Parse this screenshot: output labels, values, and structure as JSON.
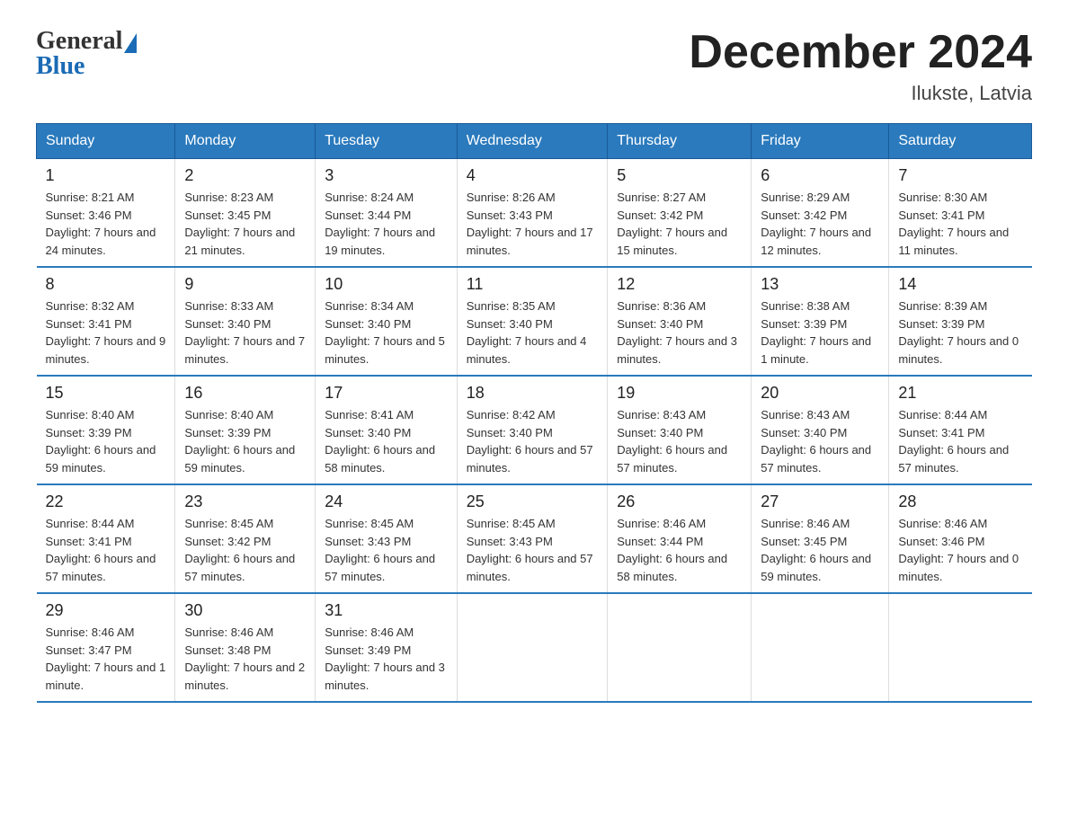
{
  "logo": {
    "general": "General",
    "blue": "Blue"
  },
  "title": "December 2024",
  "location": "Ilukste, Latvia",
  "days_of_week": [
    "Sunday",
    "Monday",
    "Tuesday",
    "Wednesday",
    "Thursday",
    "Friday",
    "Saturday"
  ],
  "weeks": [
    [
      {
        "day": "1",
        "sunrise": "8:21 AM",
        "sunset": "3:46 PM",
        "daylight": "7 hours and 24 minutes."
      },
      {
        "day": "2",
        "sunrise": "8:23 AM",
        "sunset": "3:45 PM",
        "daylight": "7 hours and 21 minutes."
      },
      {
        "day": "3",
        "sunrise": "8:24 AM",
        "sunset": "3:44 PM",
        "daylight": "7 hours and 19 minutes."
      },
      {
        "day": "4",
        "sunrise": "8:26 AM",
        "sunset": "3:43 PM",
        "daylight": "7 hours and 17 minutes."
      },
      {
        "day": "5",
        "sunrise": "8:27 AM",
        "sunset": "3:42 PM",
        "daylight": "7 hours and 15 minutes."
      },
      {
        "day": "6",
        "sunrise": "8:29 AM",
        "sunset": "3:42 PM",
        "daylight": "7 hours and 12 minutes."
      },
      {
        "day": "7",
        "sunrise": "8:30 AM",
        "sunset": "3:41 PM",
        "daylight": "7 hours and 11 minutes."
      }
    ],
    [
      {
        "day": "8",
        "sunrise": "8:32 AM",
        "sunset": "3:41 PM",
        "daylight": "7 hours and 9 minutes."
      },
      {
        "day": "9",
        "sunrise": "8:33 AM",
        "sunset": "3:40 PM",
        "daylight": "7 hours and 7 minutes."
      },
      {
        "day": "10",
        "sunrise": "8:34 AM",
        "sunset": "3:40 PM",
        "daylight": "7 hours and 5 minutes."
      },
      {
        "day": "11",
        "sunrise": "8:35 AM",
        "sunset": "3:40 PM",
        "daylight": "7 hours and 4 minutes."
      },
      {
        "day": "12",
        "sunrise": "8:36 AM",
        "sunset": "3:40 PM",
        "daylight": "7 hours and 3 minutes."
      },
      {
        "day": "13",
        "sunrise": "8:38 AM",
        "sunset": "3:39 PM",
        "daylight": "7 hours and 1 minute."
      },
      {
        "day": "14",
        "sunrise": "8:39 AM",
        "sunset": "3:39 PM",
        "daylight": "7 hours and 0 minutes."
      }
    ],
    [
      {
        "day": "15",
        "sunrise": "8:40 AM",
        "sunset": "3:39 PM",
        "daylight": "6 hours and 59 minutes."
      },
      {
        "day": "16",
        "sunrise": "8:40 AM",
        "sunset": "3:39 PM",
        "daylight": "6 hours and 59 minutes."
      },
      {
        "day": "17",
        "sunrise": "8:41 AM",
        "sunset": "3:40 PM",
        "daylight": "6 hours and 58 minutes."
      },
      {
        "day": "18",
        "sunrise": "8:42 AM",
        "sunset": "3:40 PM",
        "daylight": "6 hours and 57 minutes."
      },
      {
        "day": "19",
        "sunrise": "8:43 AM",
        "sunset": "3:40 PM",
        "daylight": "6 hours and 57 minutes."
      },
      {
        "day": "20",
        "sunrise": "8:43 AM",
        "sunset": "3:40 PM",
        "daylight": "6 hours and 57 minutes."
      },
      {
        "day": "21",
        "sunrise": "8:44 AM",
        "sunset": "3:41 PM",
        "daylight": "6 hours and 57 minutes."
      }
    ],
    [
      {
        "day": "22",
        "sunrise": "8:44 AM",
        "sunset": "3:41 PM",
        "daylight": "6 hours and 57 minutes."
      },
      {
        "day": "23",
        "sunrise": "8:45 AM",
        "sunset": "3:42 PM",
        "daylight": "6 hours and 57 minutes."
      },
      {
        "day": "24",
        "sunrise": "8:45 AM",
        "sunset": "3:43 PM",
        "daylight": "6 hours and 57 minutes."
      },
      {
        "day": "25",
        "sunrise": "8:45 AM",
        "sunset": "3:43 PM",
        "daylight": "6 hours and 57 minutes."
      },
      {
        "day": "26",
        "sunrise": "8:46 AM",
        "sunset": "3:44 PM",
        "daylight": "6 hours and 58 minutes."
      },
      {
        "day": "27",
        "sunrise": "8:46 AM",
        "sunset": "3:45 PM",
        "daylight": "6 hours and 59 minutes."
      },
      {
        "day": "28",
        "sunrise": "8:46 AM",
        "sunset": "3:46 PM",
        "daylight": "7 hours and 0 minutes."
      }
    ],
    [
      {
        "day": "29",
        "sunrise": "8:46 AM",
        "sunset": "3:47 PM",
        "daylight": "7 hours and 1 minute."
      },
      {
        "day": "30",
        "sunrise": "8:46 AM",
        "sunset": "3:48 PM",
        "daylight": "7 hours and 2 minutes."
      },
      {
        "day": "31",
        "sunrise": "8:46 AM",
        "sunset": "3:49 PM",
        "daylight": "7 hours and 3 minutes."
      },
      null,
      null,
      null,
      null
    ]
  ]
}
